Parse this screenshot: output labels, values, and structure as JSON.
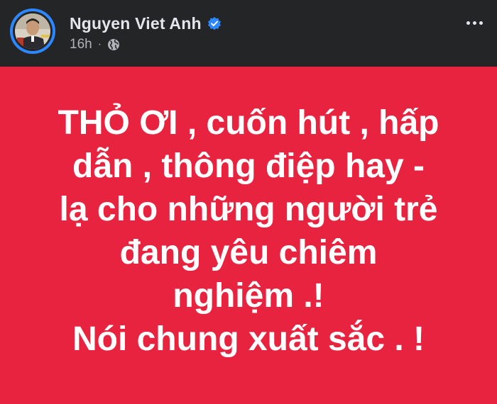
{
  "post": {
    "author": {
      "name": "Nguyen Viet Anh",
      "verified_icon": "verified-badge-icon",
      "avatar_ring_color": "#2d88ff"
    },
    "meta": {
      "time": "16h",
      "separator": "·",
      "privacy_icon": "globe-icon"
    },
    "more_icon": "more-options-icon",
    "background_color": "#e8233f",
    "text_lines": [
      "THỎ ƠI , cuốn hút , hấp",
      "dẫn , thông điệp hay -",
      "lạ cho những người trẻ",
      "đang yêu chiêm",
      "nghiệm .!",
      "Nói chung xuất sắc . !"
    ]
  }
}
